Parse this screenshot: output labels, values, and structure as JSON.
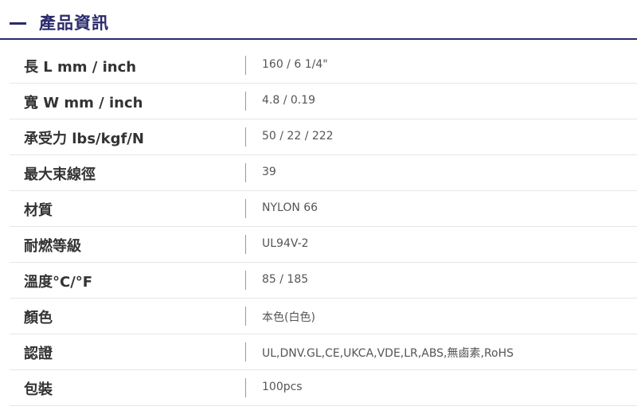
{
  "header": {
    "title": "產品資訊",
    "accent_color": "#2b2a6b"
  },
  "specs": [
    {
      "label": "長 L mm / inch",
      "value": "160 / 6 1/4\""
    },
    {
      "label": "寬 W mm / inch",
      "value": "4.8 / 0.19"
    },
    {
      "label": "承受力 lbs/kgf/N",
      "value": "50 / 22 / 222"
    },
    {
      "label": "最大束線徑",
      "value": "39"
    },
    {
      "label": "材質",
      "value": "NYLON 66"
    },
    {
      "label": "耐燃等級",
      "value": "UL94V-2"
    },
    {
      "label": "溫度°C/°F",
      "value": "85 / 185"
    },
    {
      "label": "顏色",
      "value": "本色(白色)"
    },
    {
      "label": "認證",
      "value": "UL,DNV.GL,CE,UKCA,VDE,LR,ABS,無鹵素,RoHS"
    },
    {
      "label": "包裝",
      "value": "100pcs"
    }
  ]
}
